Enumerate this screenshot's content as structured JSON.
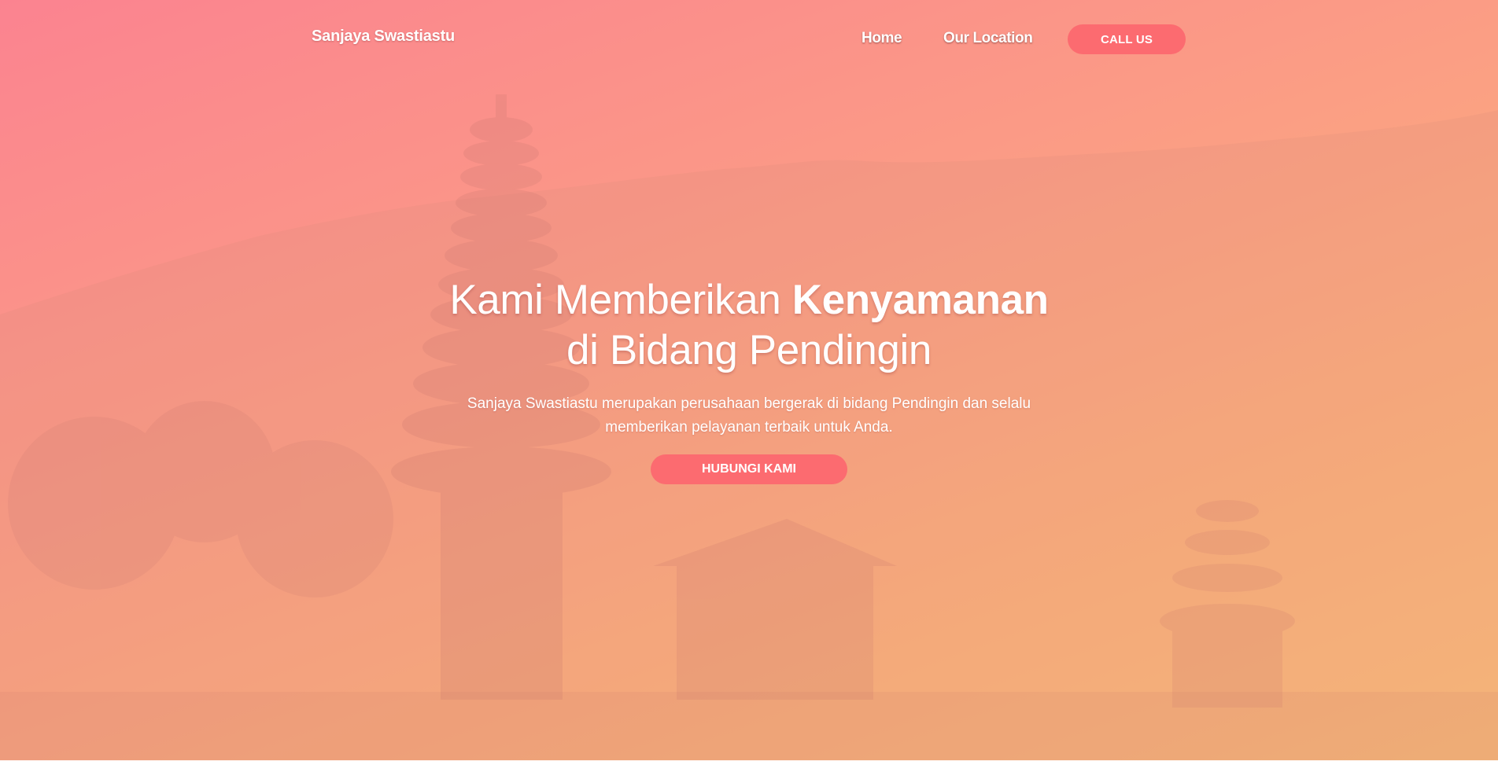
{
  "navbar": {
    "brand": "Sanjaya Swastiastu",
    "links": [
      {
        "label": "Home"
      },
      {
        "label": "Our Location"
      }
    ],
    "cta_label": "CALL US"
  },
  "hero": {
    "headline_regular": "Kami Memberikan ",
    "headline_bold": "Kenyamanan",
    "headline_line2": "di Bidang Pendingin",
    "subtitle_line1": "Sanjaya Swastiastu merupakan perusahaan bergerak di bidang Pendingin dan selalu",
    "subtitle_line2": "memberikan pelayanan terbaik untuk Anda.",
    "cta_label": "HUBUNGI KAMI"
  },
  "colors": {
    "gradient_start": "#fb8390",
    "gradient_end": "#fbbe78",
    "accent_button": "#fc6b70",
    "text": "#ffffff"
  }
}
